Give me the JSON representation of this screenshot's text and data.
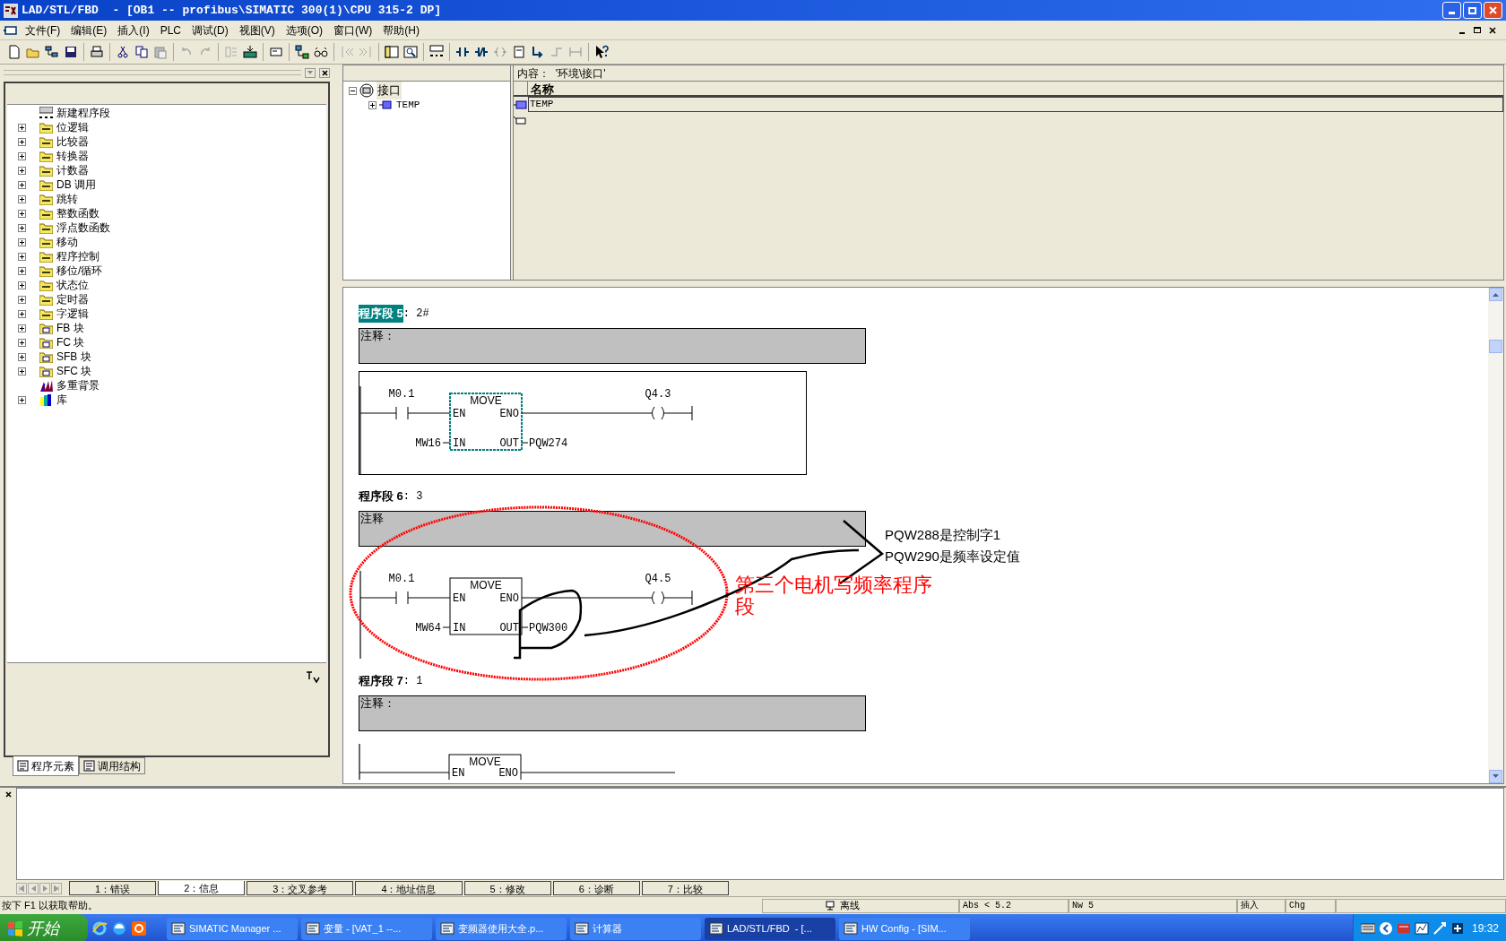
{
  "window": {
    "title": "LAD/STL/FBD  - [OB1 -- profibus\\SIMATIC 300(1)\\CPU 315-2 DP]"
  },
  "menu": [
    "文件(F)",
    "编辑(E)",
    "插入(I)",
    "PLC",
    "调试(D)",
    "视图(V)",
    "选项(O)",
    "窗口(W)",
    "帮助(H)"
  ],
  "program_elements": {
    "items": [
      {
        "label": "新建程序段",
        "kind": "new_network"
      },
      {
        "label": "位逻辑",
        "kind": "folder",
        "expanded": false
      },
      {
        "label": "比较器",
        "kind": "folder",
        "expanded": false
      },
      {
        "label": "转换器",
        "kind": "folder",
        "expanded": false
      },
      {
        "label": "计数器",
        "kind": "folder",
        "expanded": false
      },
      {
        "label": "DB 调用",
        "kind": "folder",
        "expanded": false
      },
      {
        "label": "跳转",
        "kind": "folder",
        "expanded": false
      },
      {
        "label": "整数函数",
        "kind": "folder",
        "expanded": false
      },
      {
        "label": "浮点数函数",
        "kind": "folder",
        "expanded": false
      },
      {
        "label": "移动",
        "kind": "folder",
        "expanded": false
      },
      {
        "label": "程序控制",
        "kind": "folder",
        "expanded": false
      },
      {
        "label": "移位/循环",
        "kind": "folder",
        "expanded": false
      },
      {
        "label": "状态位",
        "kind": "folder",
        "expanded": false
      },
      {
        "label": "定时器",
        "kind": "folder",
        "expanded": false
      },
      {
        "label": "字逻辑",
        "kind": "folder",
        "expanded": false
      },
      {
        "label": "FB 块",
        "kind": "block_folder",
        "expanded": false
      },
      {
        "label": "FC 块",
        "kind": "block_folder",
        "expanded": false
      },
      {
        "label": "SFB 块",
        "kind": "block_folder",
        "expanded": false
      },
      {
        "label": "SFC 块",
        "kind": "block_folder",
        "expanded": false
      },
      {
        "label": "多重背景",
        "kind": "multi_instance"
      },
      {
        "label": "库",
        "kind": "library",
        "expanded": false
      }
    ],
    "tabs": [
      {
        "label": "程序元素",
        "selected": true
      },
      {
        "label": "调用结构",
        "selected": false
      }
    ]
  },
  "interface": {
    "tree": [
      {
        "label": "接口",
        "expanded": true,
        "children": [
          {
            "label": "TEMP",
            "expanded": false
          }
        ]
      }
    ],
    "content_label": "内容：  '环境\\接口'",
    "columns": [
      "名称"
    ],
    "rows": [
      "TEMP"
    ]
  },
  "networks": [
    {
      "label": "程序段 5",
      "title": ": 2#",
      "selected": true,
      "comment": "注释：",
      "rung": {
        "kind": "move",
        "contact": "M0.1",
        "box": "MOVE",
        "pins": [
          "EN",
          "ENO",
          "IN",
          "OUT"
        ],
        "input": "MW16",
        "output": "PQW274",
        "coil": "Q4.3"
      }
    },
    {
      "label": "程序段 6",
      "title": ": 3",
      "selected": false,
      "comment": "注释",
      "rung": {
        "kind": "move",
        "contact": "M0.1",
        "box": "MOVE",
        "pins": [
          "EN",
          "ENO",
          "IN",
          "OUT"
        ],
        "input": "MW64",
        "output": "PQW300",
        "coil": "Q4.5"
      }
    },
    {
      "label": "程序段 7",
      "title": ": 1",
      "selected": false,
      "comment": "注释：",
      "rung": {
        "kind": "partial",
        "box": "MOVE",
        "pins": [
          "EN",
          "ENO"
        ]
      }
    }
  ],
  "annotations": {
    "notes": [
      "PQW288是控制字1",
      "PQW290是频率设定值"
    ],
    "caption": "第三个电机写频率程序段"
  },
  "output": {
    "tabs": [
      {
        "label": "1：错误",
        "selected": false
      },
      {
        "label": "2：信息",
        "selected": true
      },
      {
        "label": "3：交叉参考",
        "selected": false
      },
      {
        "label": "4：地址信息",
        "selected": false
      },
      {
        "label": "5：修改",
        "selected": false
      },
      {
        "label": "6：诊断",
        "selected": false
      },
      {
        "label": "7：比较",
        "selected": false
      }
    ]
  },
  "status_bar": {
    "help": "按下 F1 以获取帮助。",
    "mode": "离线",
    "position": "Abs < 5.2",
    "network": "Nw 5",
    "insert": "插入",
    "change": "Chg"
  },
  "taskbar": {
    "start": "开始",
    "items": [
      {
        "label": "SIMATIC Manager ...",
        "selected": false
      },
      {
        "label": "变量 - [VAT_1 --...",
        "selected": false
      },
      {
        "label": "变频器使用大全.p...",
        "selected": false
      },
      {
        "label": "计算器",
        "selected": false
      },
      {
        "label": "LAD/STL/FBD  - [...",
        "selected": true
      },
      {
        "label": "HW Config - [SIM...",
        "selected": false
      }
    ],
    "clock": "19:32"
  }
}
